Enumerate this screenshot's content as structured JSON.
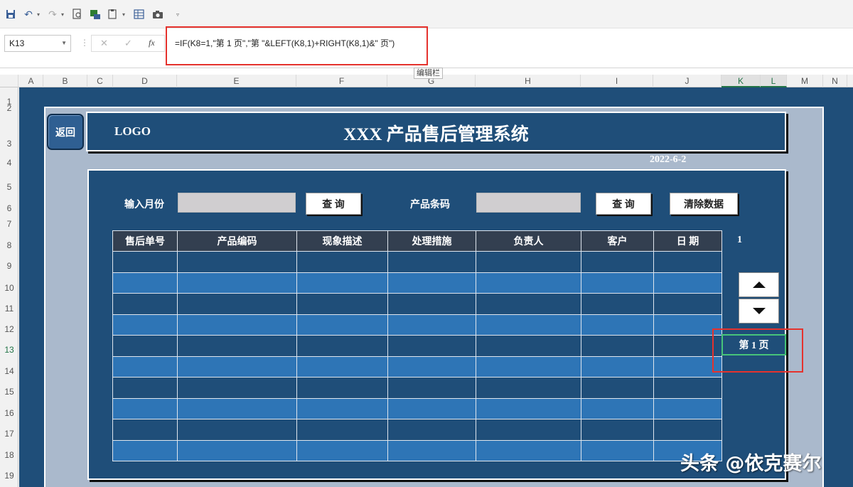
{
  "toolbar": {
    "icons": [
      "save-icon",
      "undo-icon",
      "redo-icon",
      "print-preview-icon",
      "format-painter-icon",
      "paste-special-icon",
      "table-icon",
      "camera-icon",
      "customize-icon"
    ]
  },
  "formula_bar": {
    "name_box": "K13",
    "cancel_glyph": "✕",
    "enter_glyph": "✓",
    "fx_glyph": "fx",
    "formula": "=IF(K8=1,\"第 1 页\",\"第 \"&LEFT(K8,1)+RIGHT(K8,1)&\" 页\")",
    "tooltip": "编辑栏"
  },
  "column_headers": [
    "A",
    "B",
    "C",
    "D",
    "E",
    "F",
    "G",
    "H",
    "I",
    "J",
    "K",
    "L",
    "M",
    "N"
  ],
  "row_headers": [
    "1",
    "2",
    "3",
    "4",
    "5",
    "6",
    "7",
    "8",
    "9",
    "10",
    "11",
    "12",
    "13",
    "14",
    "15",
    "16",
    "17",
    "18",
    "19"
  ],
  "selected_column": "K",
  "selected_row": "13",
  "dashboard": {
    "back_button": "返回",
    "logo": "LOGO",
    "title": "XXX 产品售后管理系统",
    "date": "2022-6-2",
    "month_label": "输入月份",
    "month_value": "",
    "query1": "查 询",
    "barcode_label": "产品条码",
    "barcode_value": "",
    "query2": "查 询",
    "clear_button": "清除数据",
    "table_headers": [
      "售后单号",
      "产品编码",
      "现象描述",
      "处理措施",
      "负责人",
      "客户",
      "日 期"
    ],
    "page_value": "1",
    "page_label": "第 1 页"
  },
  "colors": {
    "dark_blue": "#1f4e79",
    "row_blue": "#2e75b6",
    "header_dark": "#333f50",
    "highlight_red": "#e5322d"
  },
  "watermark": "头条 @依克赛尔"
}
